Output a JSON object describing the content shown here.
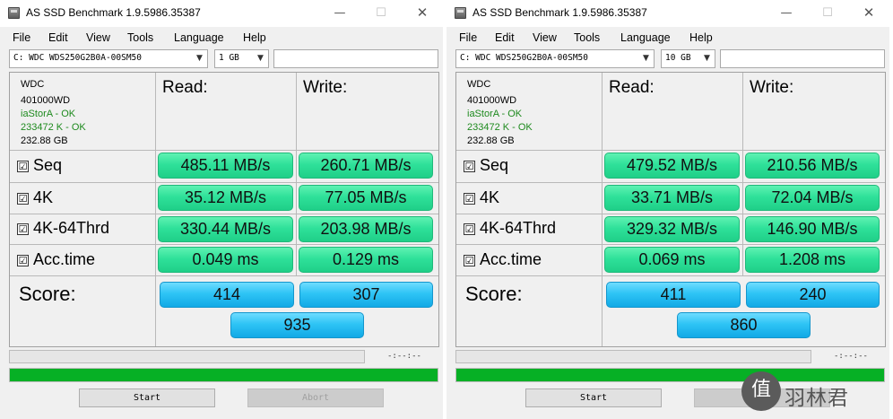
{
  "windows": [
    {
      "title": "AS SSD Benchmark 1.9.5986.35387",
      "controls": {
        "minimize": "—",
        "maximize": "☐",
        "close": "✕"
      },
      "menu": [
        "File",
        "Edit",
        "View",
        "Tools",
        "Language",
        "Help"
      ],
      "drive": "C: WDC  WDS250G2B0A-00SM50",
      "size": "1 GB",
      "info": {
        "firmware": "WDC",
        "model": "401000WD",
        "driver": "iaStorA - OK",
        "align": "233472 K - OK",
        "capacity": "232.88 GB"
      },
      "headers": {
        "read": "Read:",
        "write": "Write:"
      },
      "checkmark": "☑",
      "rows": [
        {
          "label": "Seq",
          "read": "485.11 MB/s",
          "write": "260.71 MB/s"
        },
        {
          "label": "4K",
          "read": "35.12 MB/s",
          "write": "77.05 MB/s"
        },
        {
          "label": "4K-64Thrd",
          "read": "330.44 MB/s",
          "write": "203.98 MB/s"
        },
        {
          "label": "Acc.time",
          "read": "0.049 ms",
          "write": "0.129 ms"
        }
      ],
      "score": {
        "label": "Score:",
        "read": "414",
        "write": "307",
        "total": "935"
      },
      "time": "-:--:--",
      "progress": 1.0,
      "buttons": {
        "start": "Start",
        "abort": "Abort"
      }
    },
    {
      "title": "AS SSD Benchmark 1.9.5986.35387",
      "controls": {
        "minimize": "—",
        "maximize": "☐",
        "close": "✕"
      },
      "menu": [
        "File",
        "Edit",
        "View",
        "Tools",
        "Language",
        "Help"
      ],
      "drive": "C: WDC  WDS250G2B0A-00SM50",
      "size": "10 GB",
      "info": {
        "firmware": "WDC",
        "model": "401000WD",
        "driver": "iaStorA - OK",
        "align": "233472 K - OK",
        "capacity": "232.88 GB"
      },
      "headers": {
        "read": "Read:",
        "write": "Write:"
      },
      "checkmark": "☑",
      "rows": [
        {
          "label": "Seq",
          "read": "479.52 MB/s",
          "write": "210.56 MB/s"
        },
        {
          "label": "4K",
          "read": "33.71 MB/s",
          "write": "72.04 MB/s"
        },
        {
          "label": "4K-64Thrd",
          "read": "329.32 MB/s",
          "write": "146.90 MB/s"
        },
        {
          "label": "Acc.time",
          "read": "0.069 ms",
          "write": "1.208 ms"
        }
      ],
      "score": {
        "label": "Score:",
        "read": "411",
        "write": "240",
        "total": "860"
      },
      "time": "-:--:--",
      "progress": 1.0,
      "buttons": {
        "start": "Start",
        "abort": "Abort"
      }
    }
  ],
  "watermark": {
    "icon": "值",
    "text": "羽林君"
  },
  "icons": {
    "app": "drive-icon",
    "dropdown": "▼"
  }
}
